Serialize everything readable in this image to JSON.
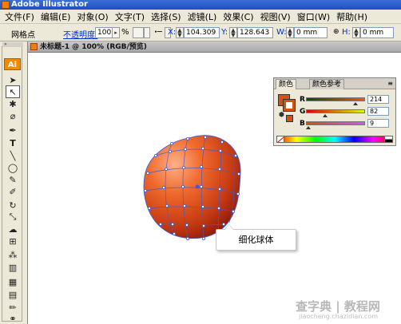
{
  "window": {
    "title": "Adobe Illustrator"
  },
  "menu": [
    "文件(F)",
    "编辑(E)",
    "对象(O)",
    "文字(T)",
    "选择(S)",
    "滤镜(L)",
    "效果(C)",
    "视图(V)",
    "窗口(W)",
    "帮助(H)"
  ],
  "control_bar": {
    "mode_label": "网格点",
    "opacity_label": "不透明度:",
    "opacity_value": "100",
    "opacity_unit": "%",
    "x_label": "X:",
    "x_value": "104.309 mm",
    "y_label": "Y:",
    "y_value": "128.643 mm",
    "w_label": "W:",
    "w_value": "0 mm",
    "h_label": "H:",
    "h_value": "0 mm"
  },
  "document": {
    "title": "未标题-1 @ 100% (RGB/预览)"
  },
  "toolbox": {
    "logo": "Ai",
    "tools": [
      "selection-icon",
      "direct-selection-icon",
      "magic-wand-icon",
      "lasso-icon",
      "pen-icon",
      "type-icon",
      "line-icon",
      "ellipse-icon",
      "paintbrush-icon",
      "pencil-icon",
      "rotate-icon",
      "scale-icon",
      "warp-icon",
      "free-transform-icon",
      "symbol-sprayer-icon",
      "graph-icon",
      "mesh-icon",
      "gradient-icon",
      "eyedropper-icon",
      "blend-icon"
    ]
  },
  "color_panel": {
    "tabs": [
      "颜色",
      "颜色参考"
    ],
    "fill_color": "#d65209",
    "channels": [
      {
        "label": "R",
        "value": "214",
        "level": 0.839
      },
      {
        "label": "G",
        "value": "82",
        "level": 0.322
      },
      {
        "label": "B",
        "value": "9",
        "level": 0.035
      }
    ]
  },
  "callout": {
    "text": "细化球体"
  },
  "watermark": {
    "line1": "查字典 | 教程网",
    "line2": "jiaocheng.chazidian.com"
  },
  "colors": {
    "sphere_light": "#ff9a6a",
    "sphere_mid": "#e2501e",
    "sphere_dark": "#9a1e0a",
    "mesh": "#3a5cd8"
  }
}
